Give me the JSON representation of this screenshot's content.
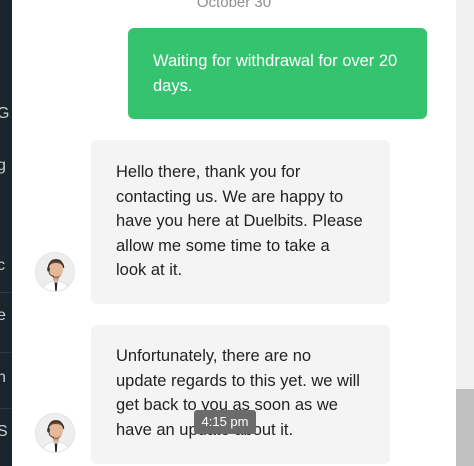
{
  "background_page": {
    "edge_letters": [
      "G",
      "g",
      "c",
      "e",
      "n",
      "S"
    ]
  },
  "chat": {
    "date_separator": "October 30",
    "messages": [
      {
        "sender": "user",
        "text": "Waiting for withdrawal for over 20 days."
      },
      {
        "sender": "agent",
        "text": "Hello there, thank you for contacting us. We are happy to have you here at Duelbits. Please allow me some time to take a look at it."
      },
      {
        "sender": "agent",
        "text": "Unfortunately, there are no update regards to this yet. we will get back to you as soon as we have an update about it.",
        "timestamp": "4:15 pm"
      }
    ]
  },
  "colors": {
    "user_bubble": "#34c46f",
    "agent_bubble": "#f4f4f4",
    "timestamp_pill": "#6b6b6b",
    "left_strip": "#1b262c"
  },
  "icons": {
    "avatar": "support-agent-avatar"
  }
}
